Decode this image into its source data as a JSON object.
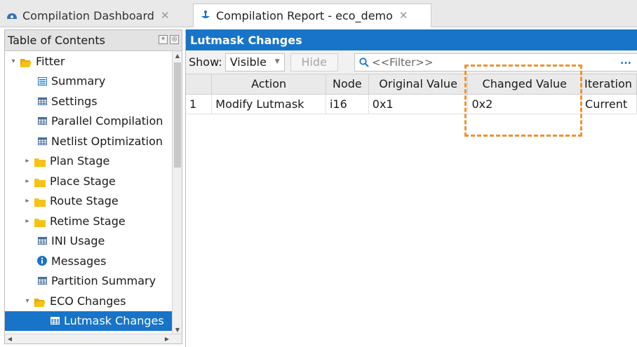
{
  "tabs": [
    {
      "label": "Compilation Dashboard",
      "close": "✕",
      "active": false
    },
    {
      "label": "Compilation Report - eco_demo",
      "close": "✕",
      "active": true
    }
  ],
  "left_panel": {
    "title": "Table of Contents",
    "tree": [
      {
        "label": "Fitter",
        "icon": "folder-open-icon",
        "expanded": true
      },
      {
        "label": "Summary",
        "icon": "summary-icon"
      },
      {
        "label": "Settings",
        "icon": "table-icon"
      },
      {
        "label": "Parallel Compilation",
        "icon": "table-icon"
      },
      {
        "label": "Netlist Optimization",
        "icon": "table-icon"
      },
      {
        "label": "Plan Stage",
        "icon": "folder-icon",
        "expanded": false
      },
      {
        "label": "Place Stage",
        "icon": "folder-icon",
        "expanded": false
      },
      {
        "label": "Route Stage",
        "icon": "folder-icon",
        "expanded": false
      },
      {
        "label": "Retime Stage",
        "icon": "folder-icon",
        "expanded": false
      },
      {
        "label": "INI Usage",
        "icon": "table-icon"
      },
      {
        "label": "Messages",
        "icon": "info-icon"
      },
      {
        "label": "Partition Summary",
        "icon": "table-icon"
      },
      {
        "label": "ECO Changes",
        "icon": "folder-open-icon",
        "expanded": true
      },
      {
        "label": "Lutmask Changes",
        "icon": "table-icon",
        "selected": true
      }
    ]
  },
  "report": {
    "title": "Lutmask Changes",
    "show_label": "Show:",
    "show_value": "Visible",
    "hide_label": "Hide",
    "filter_placeholder": "<<Filter>>",
    "more": "...",
    "columns": [
      "",
      "Action",
      "Node",
      "Original Value",
      "Changed Value",
      "Iteration"
    ],
    "rows": [
      [
        "1",
        "Modify Lutmask",
        "i16",
        "0x1",
        "0x2",
        "Current"
      ]
    ]
  },
  "colors": {
    "accent": "#1874c8",
    "highlight_box": "#f0922f"
  }
}
